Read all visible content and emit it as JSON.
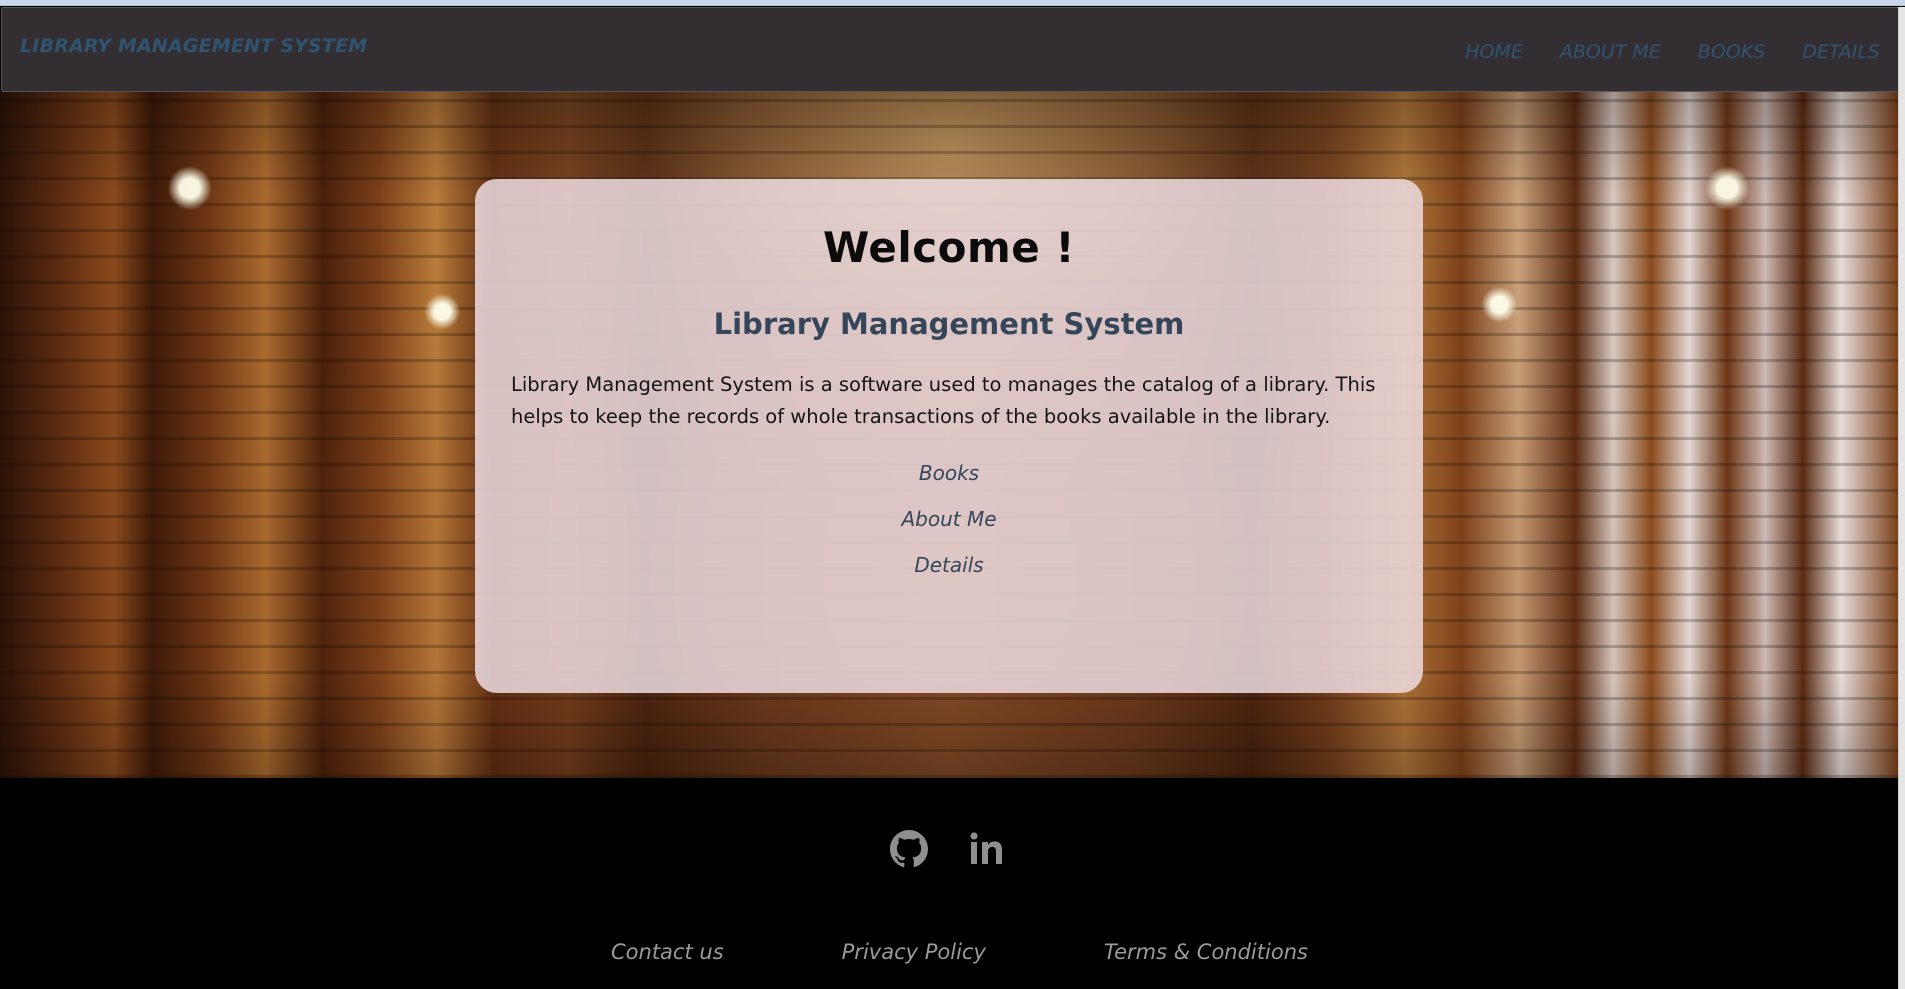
{
  "navbar": {
    "brand": "LIBRARY MANAGEMENT SYSTEM",
    "links": [
      "HOME",
      "ABOUT ME",
      "BOOKS",
      "DETAILS"
    ]
  },
  "card": {
    "title": "Welcome !",
    "subtitle": "Library Management System",
    "description": "Library Management System is a software used to manages the catalog of a library. This helps to keep the records of whole transactions of the books available in the library.",
    "links": [
      "Books",
      "About Me",
      "Details"
    ]
  },
  "footer": {
    "social_icons": [
      "github-icon",
      "linkedin-icon"
    ],
    "links": [
      "Contact us",
      "Privacy Policy",
      "Terms & Conditions"
    ]
  },
  "colors": {
    "navbar_bg": "#332e31",
    "nav_text": "#2f5370",
    "card_bg": "#ecdbe0",
    "subtitle_text": "#35465a",
    "footer_bg": "#000000",
    "footer_text": "#9a9a9a"
  }
}
